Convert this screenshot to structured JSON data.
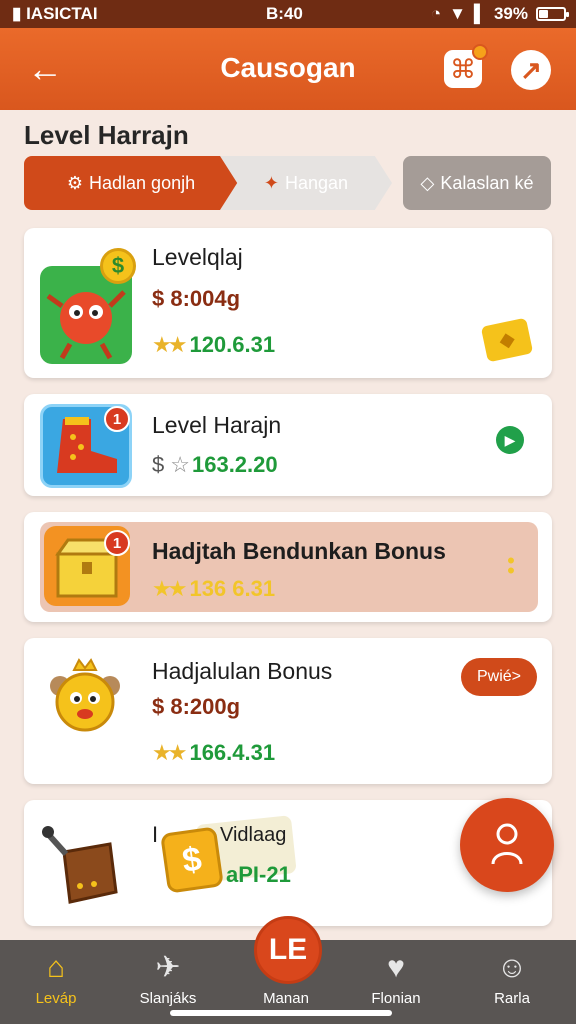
{
  "status_bar": {
    "carrier": "▮ IASICTAI",
    "time": "B:40",
    "battery": "39%",
    "battery_level": 0.39
  },
  "header": {
    "title": "Causogan",
    "colors": {
      "bar": "#d9571e",
      "accent": "#f6a21a"
    }
  },
  "section_title": "Level Harrajn",
  "tabs": [
    {
      "label": "Hadlan gonjh",
      "icon": "gear-icon",
      "active": true
    },
    {
      "label": "Hangan",
      "icon": "ticket-icon",
      "active": false
    },
    {
      "label": "Kalaslan ké",
      "icon": "diamond-icon",
      "active": false
    }
  ],
  "items": [
    {
      "name": "Levelqlaj",
      "price": "$ 8:004g",
      "rating_value": "120.6.31",
      "thumb_icon": "monster-icon"
    },
    {
      "name": "Level Harajn",
      "price_prefix": "$",
      "rating_value": "163.2.20",
      "badge": "1",
      "thumb_icon": "boot-icon"
    },
    {
      "name": "Hadjtah Bendunkan Bonus",
      "rating_value": "136 6.31",
      "badge": "1",
      "thumb_icon": "chest-icon"
    },
    {
      "name": "Hadjalulan Bonus",
      "price": "$ 8:200g",
      "rating_value": "166.4.31",
      "button_label": "Pwié>",
      "thumb_icon": "crowned-monster-icon"
    },
    {
      "name_prefix": "I",
      "tag_text": "Vidlaag",
      "value": "aPI-21",
      "thumb_icon": "pot-icon"
    }
  ],
  "bottom_nav": [
    {
      "label": "Leváp",
      "icon": "home-icon",
      "active": true
    },
    {
      "label": "Slanjáks",
      "icon": "plane-icon"
    },
    {
      "label": "Manan",
      "icon": "center-icon"
    },
    {
      "label": "Flonian",
      "icon": "heart-face-icon"
    },
    {
      "label": "Rarla",
      "icon": "user-icon"
    }
  ],
  "center_fab_label": "LE"
}
